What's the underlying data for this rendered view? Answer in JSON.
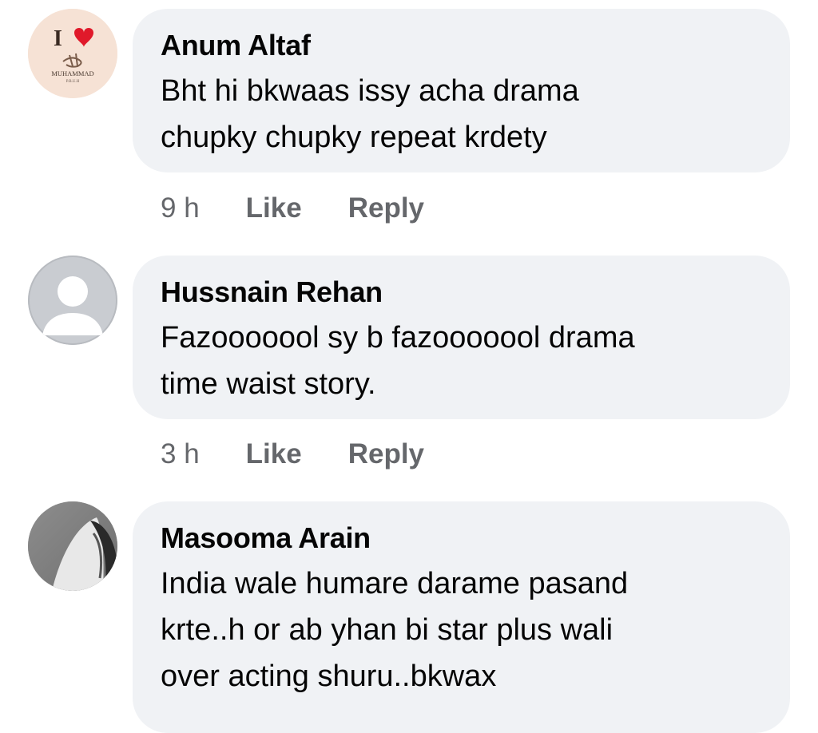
{
  "comments": [
    {
      "author": "Anum Altaf",
      "text": "Bht hi bkwaas issy acha drama\nchupky chupky repeat krdety",
      "time": "9 h",
      "like_label": "Like",
      "reply_label": "Reply",
      "avatar": {
        "icon": "i-love-muhammad-avatar",
        "letter": "I",
        "caption": "MUHAMMAD",
        "subcaption": "P.B.U.H",
        "heart_color": "#e0192a"
      }
    },
    {
      "author": "Hussnain Rehan",
      "text": "Fazooooool sy b fazooooool drama\ntime waist story.",
      "time": "3 h",
      "like_label": "Like",
      "reply_label": "Reply",
      "avatar": {
        "icon": "default-user-avatar"
      }
    },
    {
      "author": "Masooma Arain",
      "text": "India wale humare darame pasand\nkrte..h or ab yhan bi star plus wali\nover acting shuru..bkwax",
      "avatar": {
        "icon": "photo-avatar"
      }
    }
  ],
  "colors": {
    "bubble": "#f0f2f5",
    "meta_text": "#65676b",
    "primary_text": "#050505"
  }
}
